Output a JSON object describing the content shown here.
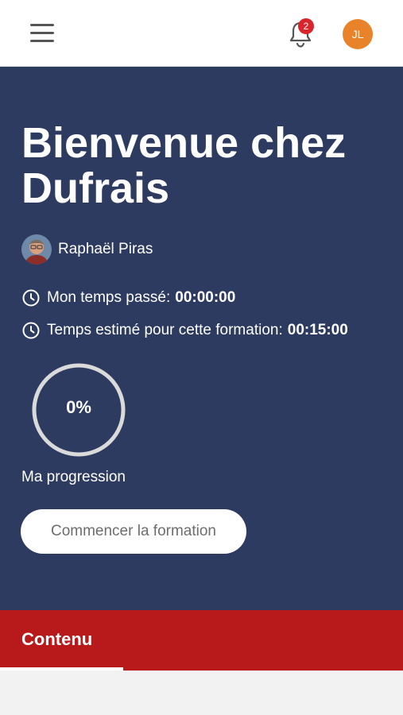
{
  "header": {
    "notification_count": "2",
    "user_initials": "JL",
    "avatar_color": "#e9832a"
  },
  "hero": {
    "title": "Bienvenue chez Dufrais",
    "author": "Raphaël Piras",
    "time_spent_label": "Mon temps passé:",
    "time_spent_value": "00:00:00",
    "time_estimated_label": "Temps estimé pour cette formation:",
    "time_estimated_value": "00:15:00",
    "progress_percent": "0%",
    "progress_label": "Ma progression",
    "start_button": "Commencer la formation",
    "background_color": "#2e3b61"
  },
  "tabs": {
    "active": "Contenu",
    "color": "#b81a1c"
  }
}
